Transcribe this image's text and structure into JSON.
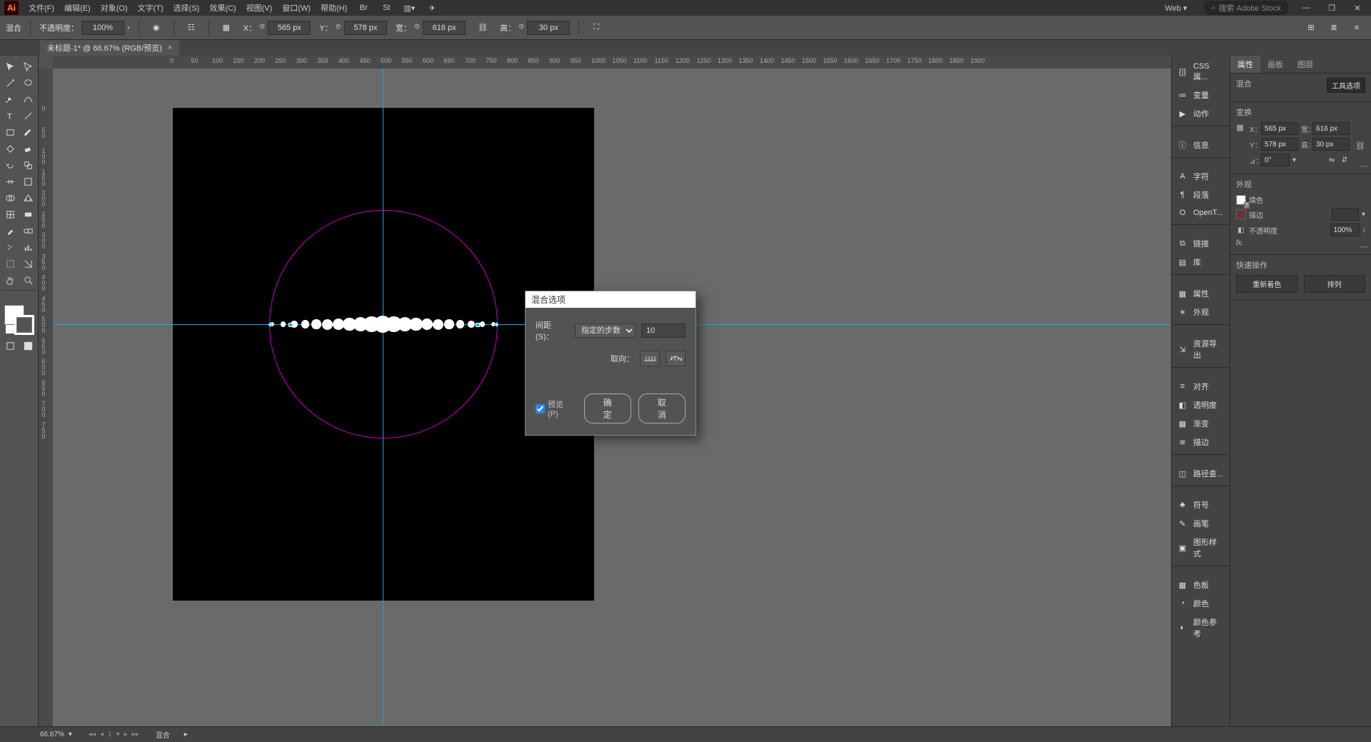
{
  "menubar": {
    "logo": "Ai",
    "items": [
      "文件(F)",
      "编辑(E)",
      "对象(O)",
      "文字(T)",
      "选择(S)",
      "效果(C)",
      "视图(V)",
      "窗口(W)",
      "帮助(H)"
    ],
    "workspace": "Web",
    "search_placeholder": "搜索 Adobe Stock"
  },
  "controlbar": {
    "object_type": "混合",
    "opacity_label": "不透明度：",
    "opacity_value": "100%",
    "x_label": "X：",
    "x_value": "565 px",
    "y_label": "Y：",
    "y_value": "578 px",
    "w_label": "宽：",
    "w_value": "616 px",
    "h_label": "高：",
    "h_value": "30 px"
  },
  "document_tab": {
    "title": "未标题-1* @ 66.67% (RGB/预览)"
  },
  "ruler_h": [
    0,
    50,
    100,
    150,
    200,
    250,
    300,
    350,
    400,
    450,
    500,
    550,
    600,
    650,
    700,
    750,
    800,
    850,
    900,
    950,
    1000,
    1050,
    1100,
    1150,
    1200,
    1250,
    1300,
    1350,
    1400,
    1450,
    1500,
    1550,
    1600,
    1650,
    1700,
    1750,
    1800,
    1850,
    1900
  ],
  "ruler_v": [
    0,
    50,
    100,
    150,
    200,
    250,
    300,
    350,
    400,
    450,
    500,
    550,
    600,
    650,
    700,
    750
  ],
  "dialog": {
    "title": "混合选项",
    "spacing_label": "间距 (S)：",
    "spacing_option": "指定的步数",
    "spacing_value": "10",
    "orient_label": "取向：",
    "preview_label": "预览 (P)",
    "preview_checked": true,
    "ok": "确定",
    "cancel": "取消"
  },
  "panels_a": [
    {
      "icon": "css",
      "label": "CSS 属..."
    },
    {
      "icon": "var",
      "label": "变量"
    },
    {
      "icon": "play",
      "label": "动作"
    },
    {
      "sep": true
    },
    {
      "icon": "info",
      "label": "信息"
    },
    {
      "sep": true
    },
    {
      "icon": "char",
      "label": "字符"
    },
    {
      "icon": "para",
      "label": "段落"
    },
    {
      "icon": "ot",
      "label": "OpenT..."
    },
    {
      "sep": true
    },
    {
      "icon": "link",
      "label": "链接"
    },
    {
      "icon": "lib",
      "label": "库"
    },
    {
      "sep": true
    },
    {
      "icon": "prop",
      "label": "属性"
    },
    {
      "icon": "appr",
      "label": "外观"
    },
    {
      "sep": true
    },
    {
      "icon": "asset",
      "label": "资源导出"
    },
    {
      "sep": true
    },
    {
      "icon": "align",
      "label": "对齐"
    },
    {
      "icon": "trans",
      "label": "透明度"
    },
    {
      "icon": "grad",
      "label": "渐变"
    },
    {
      "icon": "stroke",
      "label": "描边"
    },
    {
      "sep": true
    },
    {
      "icon": "pf",
      "label": "路径查..."
    },
    {
      "sep": true
    },
    {
      "icon": "sym",
      "label": "符号"
    },
    {
      "icon": "brush",
      "label": "画笔"
    },
    {
      "icon": "gs",
      "label": "图形样式"
    },
    {
      "sep": true
    },
    {
      "icon": "swatch",
      "label": "色板"
    },
    {
      "icon": "color",
      "label": "颜色"
    },
    {
      "icon": "cg",
      "label": "颜色参考"
    }
  ],
  "props": {
    "tabs": [
      "属性",
      "画板",
      "图层"
    ],
    "object_type": "混合",
    "tool_options": "工具选项",
    "section_transform": "变换",
    "x_label": "X：",
    "x": "565 px",
    "y_label": "Y：",
    "y": "578 px",
    "w_label": "宽：",
    "w": "616 px",
    "h_label": "高：",
    "h": "30 px",
    "angle_label": "⊿：",
    "angle": "0°",
    "section_appearance": "外观",
    "fill_label": "填色",
    "stroke_label": "描边",
    "opacity_label": "不透明度",
    "opacity": "100%",
    "fx_label": "fx.",
    "section_quick": "快速操作",
    "recolor": "重新着色",
    "arrange": "排列"
  },
  "statusbar": {
    "zoom": "66.67%",
    "page": "1",
    "tool": "混合"
  }
}
